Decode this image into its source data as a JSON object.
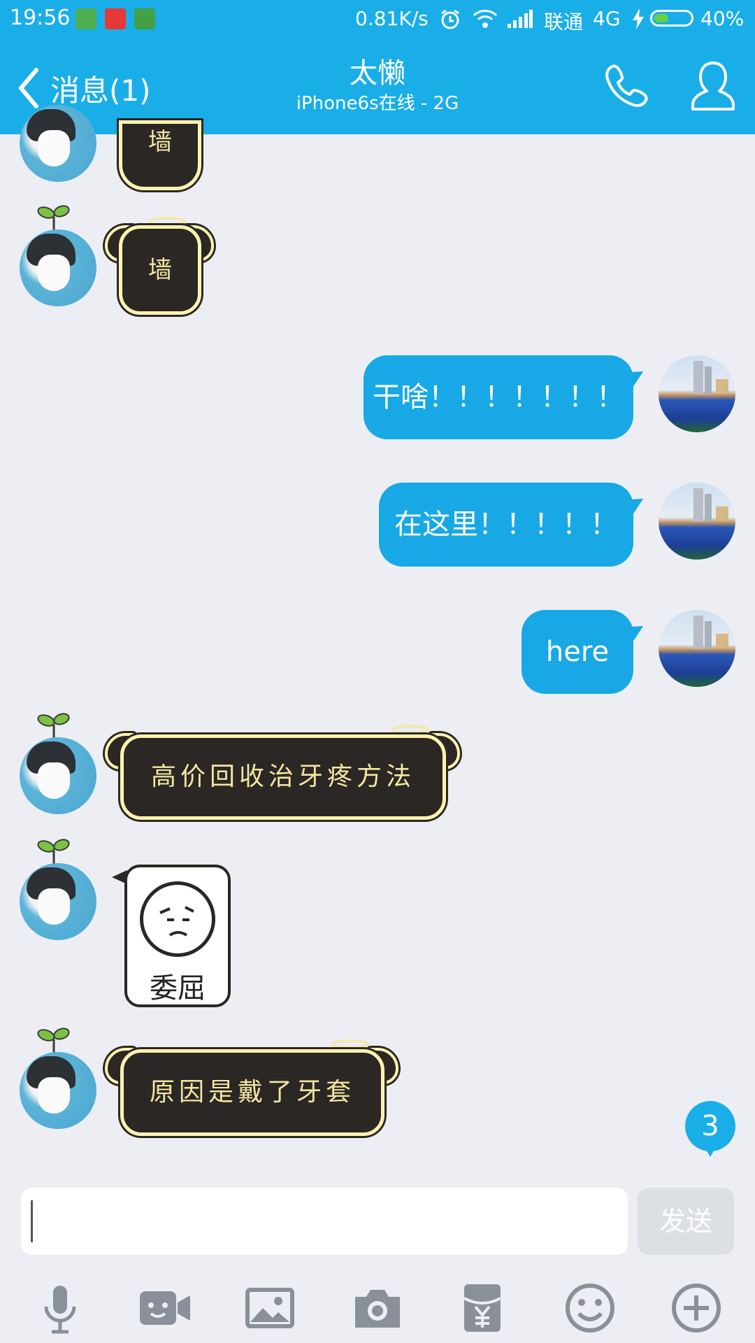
{
  "status_bar": {
    "time": "19:56",
    "network_speed": "0.81K/s",
    "carrier": "联通",
    "network_type": "4G",
    "battery_percent": "40%",
    "battery_level": 0.4,
    "notif_colors": [
      "#4caf50",
      "#e53935",
      "#43a047"
    ]
  },
  "header": {
    "back_label": "消息(1)",
    "title": "太懒",
    "subtitle": "iPhone6s在线 - 2G",
    "call_icon": "phone-icon",
    "profile_icon": "person-icon"
  },
  "messages": [
    {
      "side": "left",
      "type": "sticker",
      "text": "墙"
    },
    {
      "side": "left",
      "type": "sticker",
      "text": "墙"
    },
    {
      "side": "right",
      "type": "text",
      "text": "干啥！！！！！！！"
    },
    {
      "side": "right",
      "type": "text",
      "text": "在这里！！！！！"
    },
    {
      "side": "right",
      "type": "text",
      "text": "here"
    },
    {
      "side": "left",
      "type": "sticker",
      "text": "高价回收治牙疼方法"
    },
    {
      "side": "left",
      "type": "image-sticker",
      "text": "委屈"
    },
    {
      "side": "left",
      "type": "sticker",
      "text": "原因是戴了牙套"
    }
  ],
  "unread_badge": "3",
  "input": {
    "value": "",
    "placeholder": "",
    "send_label": "发送"
  },
  "toolbar": [
    {
      "icon": "microphone-icon"
    },
    {
      "icon": "video-call-icon"
    },
    {
      "icon": "image-icon"
    },
    {
      "icon": "camera-icon"
    },
    {
      "icon": "red-packet-icon"
    },
    {
      "icon": "emoji-icon"
    },
    {
      "icon": "plus-icon"
    }
  ],
  "colors": {
    "header_bg": "#1aaee9",
    "bubble_blue": "#18a8e6",
    "chat_bg": "#eceef3",
    "sticker_dark": "#2b2724",
    "sticker_text": "#f3e7a2"
  }
}
